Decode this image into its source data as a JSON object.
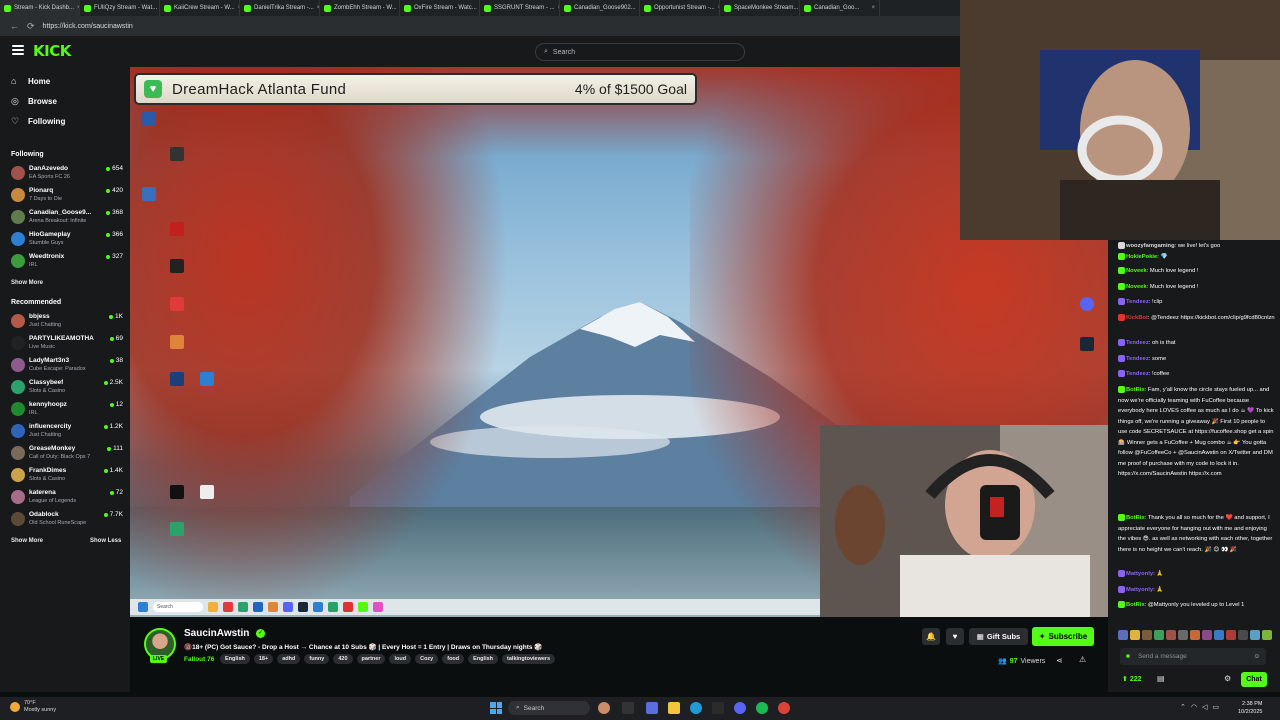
{
  "browser": {
    "tabs": [
      {
        "title": "Stream - Kick Dashb..."
      },
      {
        "title": "FUliQzy Stream - Wat..."
      },
      {
        "title": "KaiiCrew Stream - W..."
      },
      {
        "title": "DanielTrika Stream -..."
      },
      {
        "title": "ZombEhh Stream - W..."
      },
      {
        "title": "OxFire Stream - Watc..."
      },
      {
        "title": "SSGRUNT Stream - ..."
      },
      {
        "title": "Canadian_Goose902..."
      },
      {
        "title": "Opportunist Stream -..."
      },
      {
        "title": "SpaceMonkee Stream..."
      },
      {
        "title": "Canadian_Goo..."
      }
    ],
    "url": "https://kick.com/saucinawstin"
  },
  "header": {
    "logo": "KICK",
    "search_placeholder": "Search"
  },
  "sidebar": {
    "nav": [
      {
        "label": "Home",
        "icon": "home-icon"
      },
      {
        "label": "Browse",
        "icon": "compass-icon"
      },
      {
        "label": "Following",
        "icon": "heart-icon"
      }
    ],
    "following_title": "Following",
    "following": [
      {
        "name": "DanAzevedo",
        "game": "EA Sports FC 26",
        "viewers": "654",
        "color": "#a0524a"
      },
      {
        "name": "Pionarq",
        "game": "7 Days to Die",
        "viewers": "420",
        "color": "#c7893d"
      },
      {
        "name": "Canadian_Goose9...",
        "game": "Arena Breakout: Infinite",
        "viewers": "368",
        "color": "#5f7d4c"
      },
      {
        "name": "HioGameplay",
        "game": "Stumble Guys",
        "viewers": "366",
        "color": "#2c7fd1"
      },
      {
        "name": "Weedtronix",
        "game": "IRL",
        "viewers": "327",
        "color": "#3a9c3a"
      }
    ],
    "following_more": "Show More",
    "recommended_title": "Recommended",
    "recommended": [
      {
        "name": "bbjess",
        "game": "Just Chatting",
        "viewers": "1K",
        "color": "#b35a48"
      },
      {
        "name": "PARTYLIKEAMOTHA",
        "game": "Live Music",
        "viewers": "69",
        "color": "#222"
      },
      {
        "name": "LadyMart3n3",
        "game": "Cube Escape: Paradox",
        "viewers": "38",
        "color": "#8e5b8f"
      },
      {
        "name": "Classybeef",
        "game": "Slots & Casino",
        "viewers": "2.5K",
        "color": "#2aa36b"
      },
      {
        "name": "kennyhoopz",
        "game": "IRL",
        "viewers": "12",
        "color": "#1f8a2e"
      },
      {
        "name": "influencercity",
        "game": "Just Chatting",
        "viewers": "1.2K",
        "color": "#2f63b8"
      },
      {
        "name": "GreaseMonkey",
        "game": "Call of Duty: Black Ops 7",
        "viewers": "111",
        "color": "#7a6a5a"
      },
      {
        "name": "FrankDimes",
        "game": "Slots & Casino",
        "viewers": "1.4K",
        "color": "#caa34a"
      },
      {
        "name": "katerena",
        "game": "League of Legends",
        "viewers": "72",
        "color": "#a86c8a"
      },
      {
        "name": "Odablock",
        "game": "Old School RuneScape",
        "viewers": "7.7K",
        "color": "#5b4b36"
      }
    ],
    "recommended_more": "Show More",
    "recommended_less": "Show Less"
  },
  "overlay": {
    "fund_title": "DreamHack Atlanta Fund",
    "fund_goal_text": "4% of $1500 Goal"
  },
  "stream": {
    "streamer": "SaucinAwstin",
    "live_label": "LIVE",
    "title": "🔞18+ (PC) Got Sauce? - Drop a Host → Chance at 10 Subs 🎲 | Every Host = 1 Entry | Draws on Thursday nights 🎲",
    "category": "Fallout 76",
    "tags": [
      "English",
      "18+",
      "adhd",
      "funny",
      "420",
      "partner",
      "loud",
      "Cozy",
      "food",
      "English",
      "talkingtoviewers"
    ],
    "gift_subs_label": "Gift Subs",
    "subscribe_label": "Subscribe",
    "viewers_count": "97",
    "viewers_label": "Viewers"
  },
  "chat": {
    "messages": [
      {
        "user": "woozyfamgaming",
        "color": "#d9d9d9",
        "text": "we live! let's goo"
      },
      {
        "user": "HokiePokie",
        "color": "#53fc18",
        "text": "💎"
      },
      {
        "user": "Noveek",
        "color": "#53fc18",
        "text": "Much love legend !"
      },
      {
        "user": "Noveek",
        "color": "#53fc18",
        "text": "Much love legend !"
      },
      {
        "user": "Tendeez",
        "color": "#8a63f2",
        "text": "!clip"
      },
      {
        "user": "KickBot",
        "color": "#e3342f",
        "text": "@Tendeez https://kickbot.com/clip/g9fcd80cnlzn"
      },
      {
        "user": "Tendeez",
        "color": "#8a63f2",
        "text": "oh is that"
      },
      {
        "user": "Tendeez",
        "color": "#8a63f2",
        "text": "some"
      },
      {
        "user": "Tendeez",
        "color": "#8a63f2",
        "text": "!coffee"
      },
      {
        "user": "BotRix",
        "color": "#53fc18",
        "text": "Fam, y'all know the circle stays fueled up... and now we're officially teaming with FuCoffee because everybody here LOVES coffee as much as I do ☕ 💜 To kick things off, we're running a giveaway 🎉 First 10 people to use code SECRETSAUCE at https://fucoffee.shop get a spin 🎰 Winner gets a FuCoffee + Mug combo ☕ 👉 You gotta follow @FuCoffeeCo + @SaucinAwstin on X/Twitter and DM me proof of purchase with my code to lock it in. https://x.com/SaucinAwstin https://x.com"
      },
      {
        "user": "BotRix",
        "color": "#53fc18",
        "text": "Thank you all so much for the ❤️ and support, I appreciate everyone for hanging out with me and enjoying the vibes 😎. as well as networking with each other, together there is no height we can't reach. 🎉 😊 👀 🎉"
      },
      {
        "user": "Mattyonly",
        "color": "#8a63f2",
        "text": "🙏"
      },
      {
        "user": "Mattyonly",
        "color": "#8a63f2",
        "text": "🙏"
      },
      {
        "user": "BotRix",
        "color": "#53fc18",
        "text": "@Mattyonly you leveled up to Level 1"
      }
    ],
    "input_placeholder": "Send a message",
    "count": "222",
    "chat_button": "Chat"
  },
  "taskbar": {
    "weather_temp": "70°F",
    "weather_desc": "Mostly sunny",
    "search_label": "Search",
    "time": "2:38 PM",
    "date": "10/2/2025"
  }
}
